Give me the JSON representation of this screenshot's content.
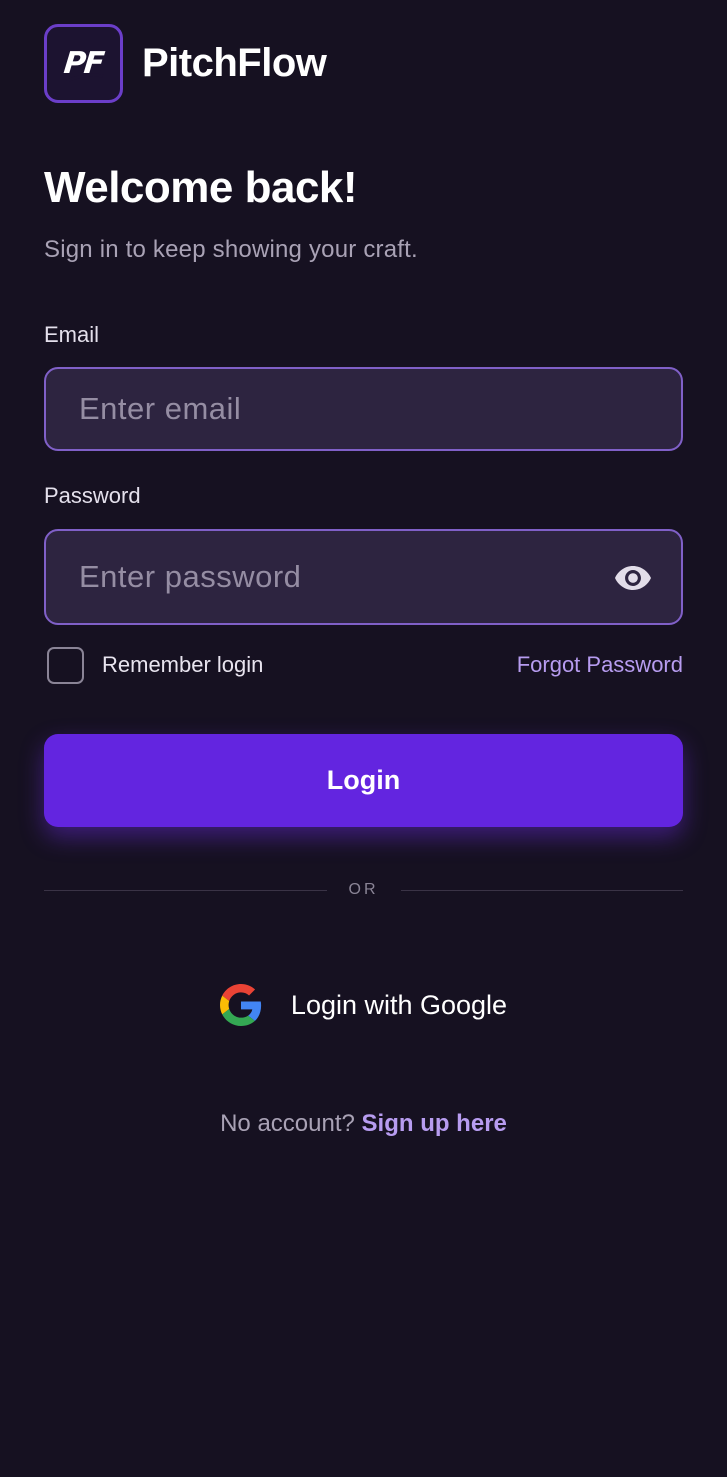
{
  "brand": {
    "logo_text": "PF",
    "name": "PitchFlow"
  },
  "header": {
    "title": "Welcome back!",
    "subtitle": "Sign in to keep showing your craft."
  },
  "form": {
    "email": {
      "label": "Email",
      "placeholder": "Enter email",
      "value": ""
    },
    "password": {
      "label": "Password",
      "placeholder": "Enter password",
      "value": "",
      "toggle_icon": "eye-icon"
    },
    "remember": {
      "label": "Remember login",
      "checked": false
    },
    "forgot_label": "Forgot Password",
    "login_label": "Login"
  },
  "divider_text": "OR",
  "google": {
    "label": "Login with Google",
    "icon": "google-icon"
  },
  "signup": {
    "prompt": "No account?",
    "link_label": "Sign up here"
  },
  "colors": {
    "background": "#161121",
    "accent": "#6325e0",
    "link": "#b79cf0",
    "input_bg": "#2d2440",
    "input_border": "#8060c8"
  }
}
